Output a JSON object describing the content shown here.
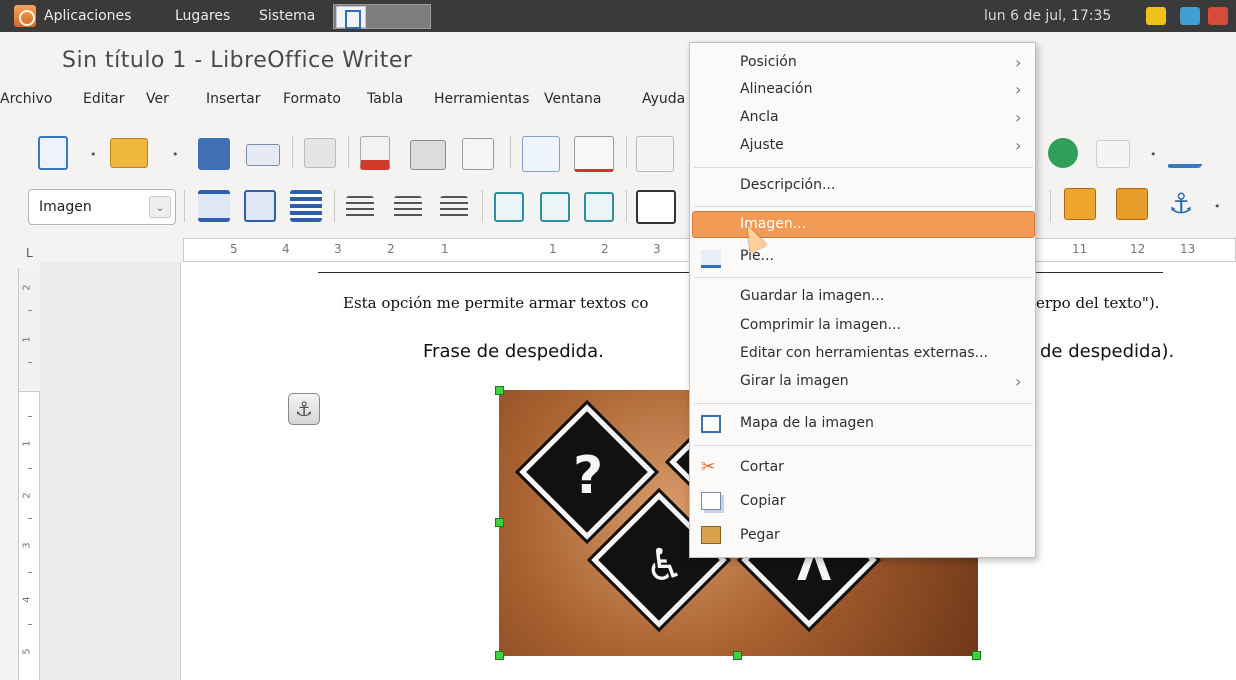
{
  "panel": {
    "menus": [
      "Aplicaciones",
      "Lugares",
      "Sistema"
    ],
    "clock": "lun  6 de jul, 17:35"
  },
  "window": {
    "title": "Sin título 1 - LibreOffice Writer"
  },
  "menubar": {
    "items": [
      "Archivo",
      "Editar",
      "Ver",
      "Insertar",
      "Formato",
      "Tabla",
      "Herramientas",
      "Ventana",
      "Ayuda"
    ]
  },
  "format_toolbar": {
    "style_value": "Imagen"
  },
  "ruler": {
    "left_labels": [
      "5",
      "4",
      "3",
      "2",
      "1"
    ],
    "right_labels": [
      "1",
      "2",
      "3"
    ],
    "far_labels": [
      "11",
      "12",
      "13"
    ]
  },
  "document": {
    "line1": "Esta opción me permite armar textos co",
    "line1_end": "erpo del texto\").",
    "line2": "Frase de despedida.",
    "line2_end": "de despedida)."
  },
  "context_menu": {
    "items": [
      {
        "label": "Posición",
        "submenu": true
      },
      {
        "label": "Alineación",
        "submenu": true
      },
      {
        "label": "Ancla",
        "submenu": true
      },
      {
        "label": "Ajuste",
        "submenu": true
      },
      {
        "label": "Descripción...",
        "submenu": false
      },
      {
        "label": "Imagen...",
        "submenu": false,
        "highlighted": true
      },
      {
        "label": "Pie...",
        "submenu": false
      },
      {
        "label": "Guardar la imagen...",
        "submenu": false
      },
      {
        "label": "Comprimir la imagen...",
        "submenu": false
      },
      {
        "label": "Editar con herramientas externas...",
        "submenu": false
      },
      {
        "label": "Girar la imagen",
        "submenu": true
      },
      {
        "label": "Mapa de la imagen",
        "submenu": false
      },
      {
        "label": "Cortar",
        "submenu": false
      },
      {
        "label": "Copiar",
        "submenu": false
      },
      {
        "label": "Pegar",
        "submenu": false
      }
    ],
    "highlight_color": "#f29b57"
  },
  "colors": {
    "panel_bg": "#3a3a3a",
    "selection_handle": "#3cd33c",
    "image_bronze": "#a8602f"
  }
}
